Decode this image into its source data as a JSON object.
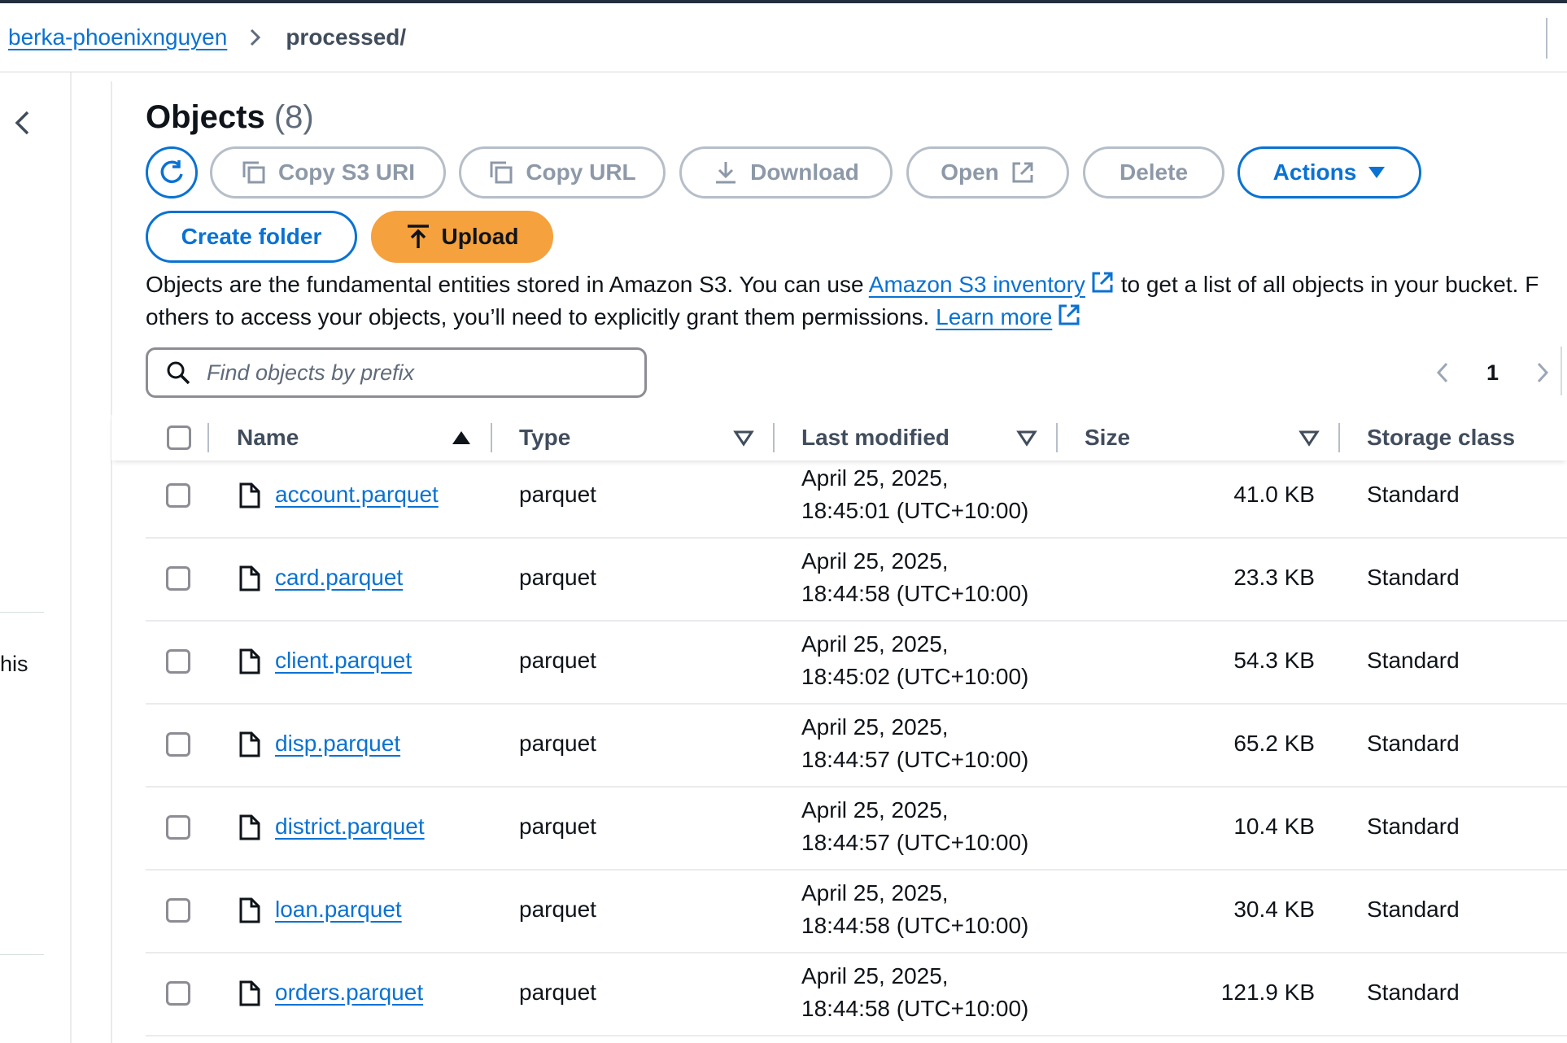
{
  "breadcrumb": {
    "bucket": "berka-phoenixnguyen",
    "folder": "processed/"
  },
  "leftnav": {
    "fragment": "his"
  },
  "objects": {
    "title": "Objects",
    "count": "(8)"
  },
  "toolbar": {
    "copy_s3_uri": "Copy S3 URI",
    "copy_url": "Copy URL",
    "download": "Download",
    "open": "Open",
    "delete": "Delete",
    "actions": "Actions",
    "create_folder": "Create folder",
    "upload": "Upload"
  },
  "description": {
    "part1": "Objects are the fundamental entities stored in Amazon S3. You can use ",
    "inventory_link": "Amazon S3 inventory",
    "part2": " to get a list of all objects in your bucket. F",
    "part3": "others to access your objects, you’ll need to explicitly grant them permissions. ",
    "learn_more": "Learn more"
  },
  "search": {
    "placeholder": "Find objects by prefix"
  },
  "pagination": {
    "page": "1"
  },
  "columns": {
    "name": "Name",
    "type": "Type",
    "last_modified": "Last modified",
    "size": "Size",
    "storage_class": "Storage class"
  },
  "rows": [
    {
      "name": "account.parquet",
      "type": "parquet",
      "date": "April 25, 2025,",
      "time": "18:45:01 (UTC+10:00)",
      "size": "41.0 KB",
      "storage": "Standard"
    },
    {
      "name": "card.parquet",
      "type": "parquet",
      "date": "April 25, 2025,",
      "time": "18:44:58 (UTC+10:00)",
      "size": "23.3 KB",
      "storage": "Standard"
    },
    {
      "name": "client.parquet",
      "type": "parquet",
      "date": "April 25, 2025,",
      "time": "18:45:02 (UTC+10:00)",
      "size": "54.3 KB",
      "storage": "Standard"
    },
    {
      "name": "disp.parquet",
      "type": "parquet",
      "date": "April 25, 2025,",
      "time": "18:44:57 (UTC+10:00)",
      "size": "65.2 KB",
      "storage": "Standard"
    },
    {
      "name": "district.parquet",
      "type": "parquet",
      "date": "April 25, 2025,",
      "time": "18:44:57 (UTC+10:00)",
      "size": "10.4 KB",
      "storage": "Standard"
    },
    {
      "name": "loan.parquet",
      "type": "parquet",
      "date": "April 25, 2025,",
      "time": "18:44:58 (UTC+10:00)",
      "size": "30.4 KB",
      "storage": "Standard"
    },
    {
      "name": "orders.parquet",
      "type": "parquet",
      "date": "April 25, 2025,",
      "time": "18:44:58 (UTC+10:00)",
      "size": "121.9 KB",
      "storage": "Standard"
    }
  ],
  "colors": {
    "link": "#0972d3",
    "upload_bg": "#f5a13d",
    "disabled_border": "#b6bec9",
    "text": "#0f141a"
  }
}
